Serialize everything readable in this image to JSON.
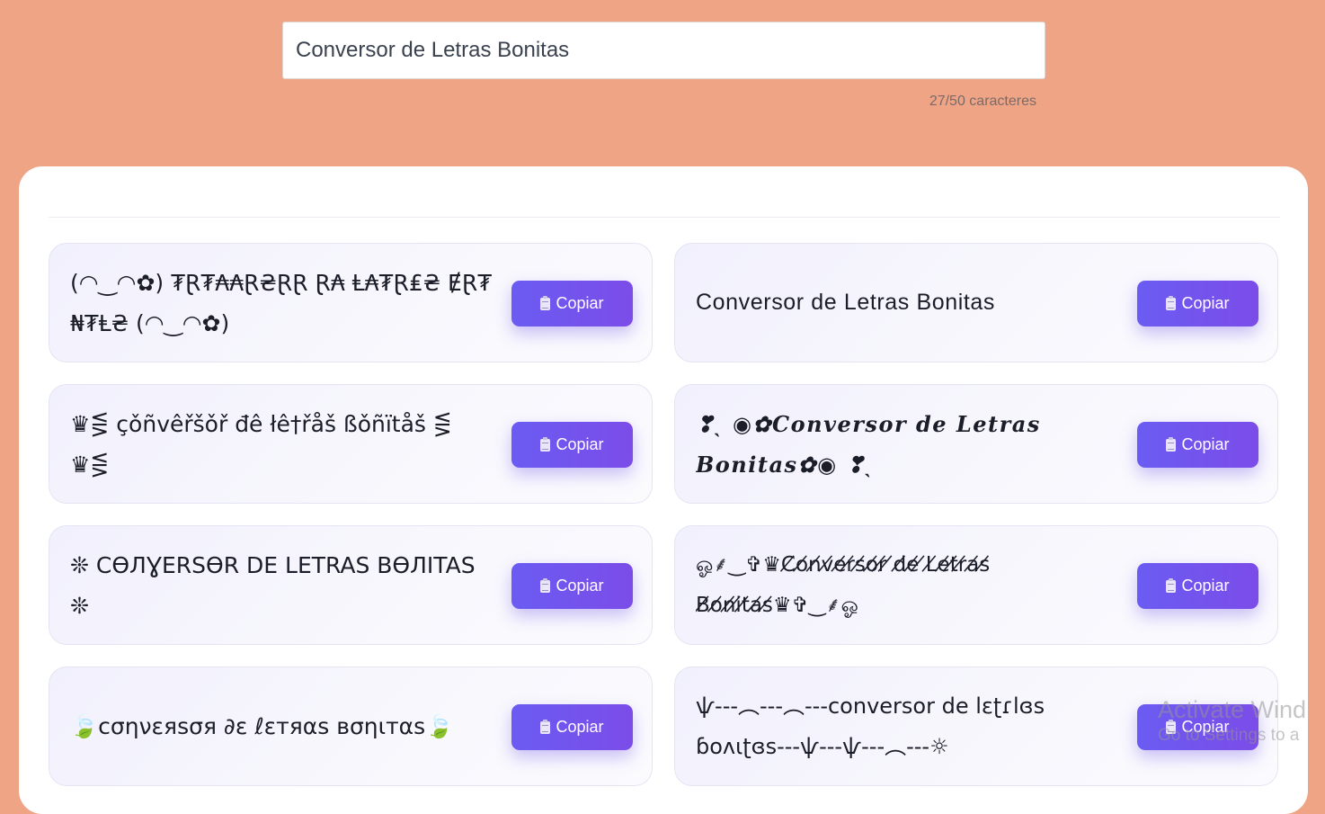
{
  "input": {
    "value": "Conversor de Letras Bonitas"
  },
  "char_count": "27/50 caracteres",
  "copy_label": "Copiar",
  "styles": [
    {
      "text": "(◠‿◠✿) ₮Ɽ₮₳₳Ɽ₴ⱤⱤ Ɽ₳ Ⱡ₳₮Ɽ₤₴ ɆⱤ₮ ₦₮Ⱡ₴ (◠‿◠✿)"
    },
    {
      "text": "Conversor de Letras Bonitas"
    },
    {
      "text": "♛⋚ çǒñvêřšǒř đê łê†řåš ßǒñïtåš ⋚ ♛⋚"
    },
    {
      "text": "❣ˎ ◉✿Conversor de Letras Bonitas✿◉ ❣ˎ"
    },
    {
      "text": "❊ CƟЛƔERSƟR DE LETRAS BƟЛITAS ❊"
    },
    {
      "text": "ஓ⸙‿✞♛C̸o̸n̸v̸e̸r̸s̸o̸r̸ ̸d̸e̸ ̸L̸e̸t̸r̸a̸s̸ ̸B̸o̸n̸i̸t̸a̸s̸♛✞‿⸙ஓ"
    },
    {
      "text": "🍃cσηνεяѕσя ∂ε ℓεтяαѕ вσηιтαѕ🍃"
    },
    {
      "text": "ѱ---︵---︵---conversor de lεʈɾlɞs ɓoʌιʈɞs---ѱ---ѱ---︵---☼"
    }
  ],
  "decor": {
    "heart_color": "#e0303a",
    "accent_start": "#6a5cf2",
    "accent_end": "#7c4ce8",
    "page_bg": "#efa486"
  },
  "watermark": {
    "line1": "Activate Wind",
    "line2": "Go to Settings to a"
  }
}
